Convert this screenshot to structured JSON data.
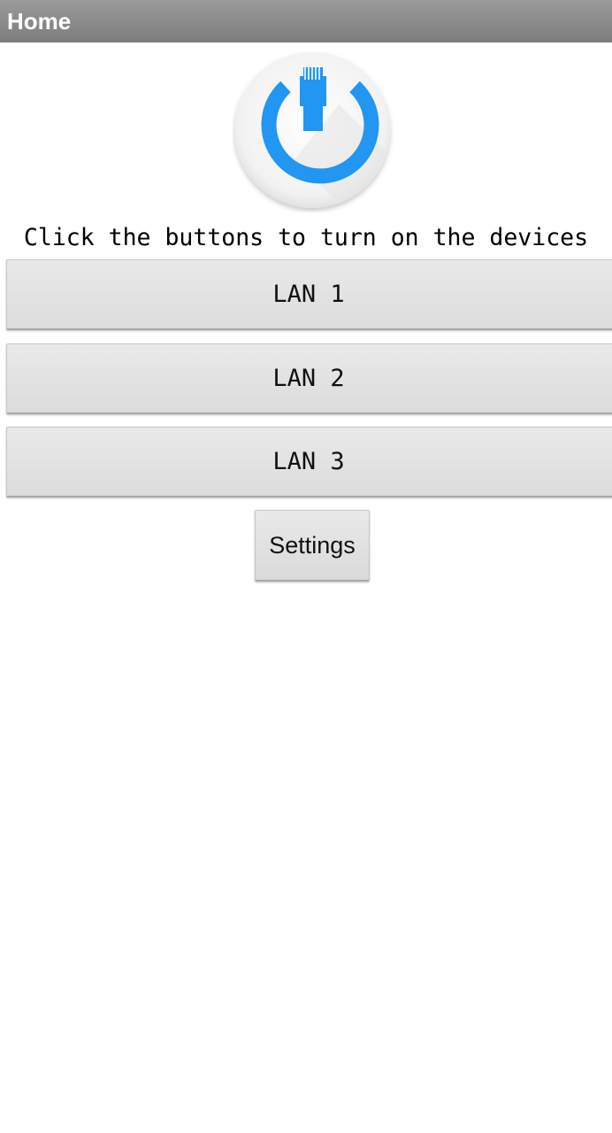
{
  "header": {
    "title": "Home"
  },
  "logo": {
    "icon": "power-ethernet-icon",
    "accent_color": "#2196f3"
  },
  "main": {
    "instruction": "Click the buttons to turn on the devices",
    "buttons": [
      {
        "label": "LAN 1"
      },
      {
        "label": "LAN 2"
      },
      {
        "label": "LAN 3"
      }
    ],
    "settings_label": "Settings"
  }
}
